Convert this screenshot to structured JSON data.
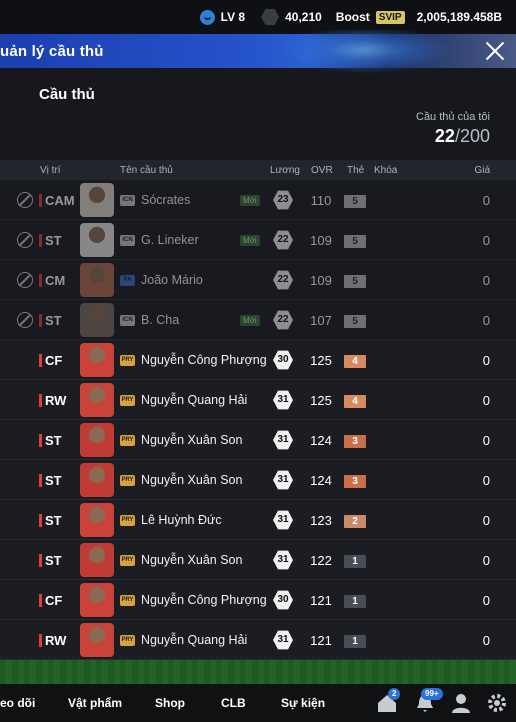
{
  "topbar": {
    "level": "LV 8",
    "coins": "40,210",
    "boost": "Boost",
    "svip": "SVIP",
    "bp": "2,005,189.458B"
  },
  "header": {
    "title": "uản lý cầu thủ"
  },
  "section": {
    "title": "Cầu thủ"
  },
  "capacity": {
    "label": "Cầu thủ của tôi",
    "current": "22",
    "max": "/200"
  },
  "columns": {
    "position": "Vị trí",
    "name": "Tên cầu thủ",
    "wage": "Lương",
    "ovr": "OVR",
    "grade": "Thẻ",
    "lock": "Khóa",
    "price": "Giá"
  },
  "players": [
    {
      "pos": "CAM",
      "name": "Sócrates",
      "card": "ICN",
      "new": "Mới",
      "wage": "23",
      "ovr": "110",
      "grade": "5",
      "price": "0"
    },
    {
      "pos": "ST",
      "name": "G. Lineker",
      "card": "ICN",
      "new": "Mới",
      "wage": "22",
      "ovr": "109",
      "grade": "5",
      "price": "0"
    },
    {
      "pos": "CM",
      "name": "João Mário",
      "card": "FA",
      "new": "",
      "wage": "22",
      "ovr": "109",
      "grade": "5",
      "price": "0"
    },
    {
      "pos": "ST",
      "name": "B. Cha",
      "card": "ICN",
      "new": "Mới",
      "wage": "22",
      "ovr": "107",
      "grade": "5",
      "price": "0"
    },
    {
      "pos": "CF",
      "name": "Nguyễn Công Phượng",
      "card": "PRY",
      "new": "",
      "wage": "30",
      "ovr": "125",
      "grade": "4",
      "price": "0"
    },
    {
      "pos": "RW",
      "name": "Nguyễn Quang Hải",
      "card": "PRY",
      "new": "",
      "wage": "31",
      "ovr": "125",
      "grade": "4",
      "price": "0"
    },
    {
      "pos": "ST",
      "name": "Nguyễn Xuân Son",
      "card": "PRY",
      "new": "",
      "wage": "31",
      "ovr": "124",
      "grade": "3",
      "price": "0"
    },
    {
      "pos": "ST",
      "name": "Nguyễn Xuân Son",
      "card": "PRY",
      "new": "",
      "wage": "31",
      "ovr": "124",
      "grade": "3",
      "price": "0"
    },
    {
      "pos": "ST",
      "name": "Lê Huỳnh Đức",
      "card": "PRY",
      "new": "",
      "wage": "31",
      "ovr": "123",
      "grade": "2",
      "price": "0"
    },
    {
      "pos": "ST",
      "name": "Nguyễn Xuân Son",
      "card": "PRY",
      "new": "",
      "wage": "31",
      "ovr": "122",
      "grade": "1",
      "price": "0"
    },
    {
      "pos": "CF",
      "name": "Nguyễn Công Phượng",
      "card": "PRY",
      "new": "",
      "wage": "30",
      "ovr": "121",
      "grade": "1",
      "price": "0"
    },
    {
      "pos": "RW",
      "name": "Nguyễn Quang Hải",
      "card": "PRY",
      "new": "",
      "wage": "31",
      "ovr": "121",
      "grade": "1",
      "price": "0"
    }
  ],
  "nav": {
    "follow": "eo dõi",
    "items": "Vật phẩm",
    "shop": "Shop",
    "club": "CLB",
    "events": "Sự kiện",
    "home_badge": "2",
    "bell_badge": "99+"
  }
}
